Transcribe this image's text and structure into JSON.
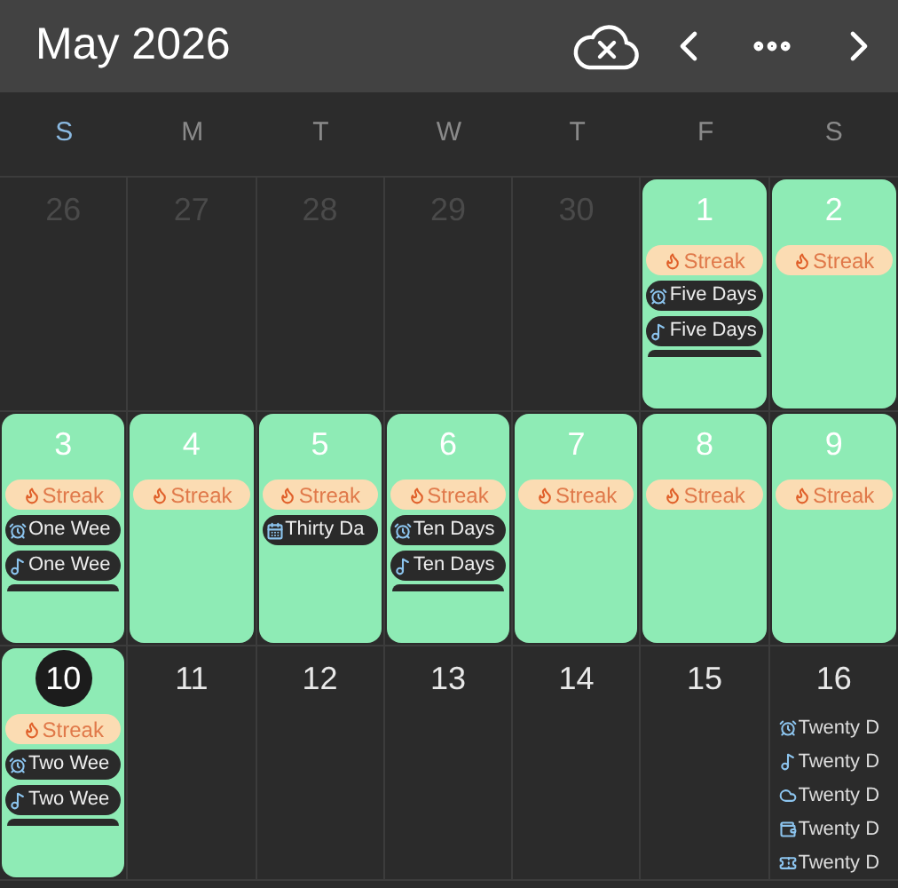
{
  "header": {
    "title": "May 2026"
  },
  "weekdays": [
    {
      "label": "S",
      "weekend": true
    },
    {
      "label": "M",
      "weekend": false
    },
    {
      "label": "T",
      "weekend": false
    },
    {
      "label": "W",
      "weekend": false
    },
    {
      "label": "T",
      "weekend": false
    },
    {
      "label": "F",
      "weekend": false
    },
    {
      "label": "S",
      "weekend": false
    }
  ],
  "weeks": [
    [
      {
        "date": "26",
        "muted": true,
        "marked": false,
        "today": false,
        "more": false
      },
      {
        "date": "27",
        "muted": true,
        "marked": false,
        "today": false,
        "more": false
      },
      {
        "date": "28",
        "muted": true,
        "marked": false,
        "today": false,
        "more": false
      },
      {
        "date": "29",
        "muted": true,
        "marked": false,
        "today": false,
        "more": false
      },
      {
        "date": "30",
        "muted": true,
        "marked": false,
        "today": false,
        "more": false
      },
      {
        "date": "1",
        "muted": false,
        "marked": true,
        "today": false,
        "events": [
          {
            "kind": "streak",
            "label": "Streak"
          },
          {
            "kind": "alarm",
            "label": "Five Days"
          },
          {
            "kind": "music",
            "label": "Five Days"
          }
        ],
        "more": true
      },
      {
        "date": "2",
        "muted": false,
        "marked": true,
        "today": false,
        "events": [
          {
            "kind": "streak",
            "label": "Streak"
          }
        ],
        "more": false
      }
    ],
    [
      {
        "date": "3",
        "muted": false,
        "marked": true,
        "today": false,
        "events": [
          {
            "kind": "streak",
            "label": "Streak"
          },
          {
            "kind": "alarm",
            "label": "One Wee"
          },
          {
            "kind": "music",
            "label": "One Wee"
          }
        ],
        "more": true
      },
      {
        "date": "4",
        "muted": false,
        "marked": true,
        "today": false,
        "events": [
          {
            "kind": "streak",
            "label": "Streak"
          }
        ],
        "more": false
      },
      {
        "date": "5",
        "muted": false,
        "marked": true,
        "today": false,
        "events": [
          {
            "kind": "streak",
            "label": "Streak"
          },
          {
            "kind": "calendar",
            "label": "Thirty Da"
          }
        ],
        "more": false
      },
      {
        "date": "6",
        "muted": false,
        "marked": true,
        "today": false,
        "events": [
          {
            "kind": "streak",
            "label": "Streak"
          },
          {
            "kind": "alarm",
            "label": "Ten Days"
          },
          {
            "kind": "music",
            "label": "Ten Days"
          }
        ],
        "more": true
      },
      {
        "date": "7",
        "muted": false,
        "marked": true,
        "today": false,
        "events": [
          {
            "kind": "streak",
            "label": "Streak"
          }
        ],
        "more": false
      },
      {
        "date": "8",
        "muted": false,
        "marked": true,
        "today": false,
        "events": [
          {
            "kind": "streak",
            "label": "Streak"
          }
        ],
        "more": false
      },
      {
        "date": "9",
        "muted": false,
        "marked": true,
        "today": false,
        "events": [
          {
            "kind": "streak",
            "label": "Streak"
          }
        ],
        "more": false
      }
    ],
    [
      {
        "date": "10",
        "muted": false,
        "marked": true,
        "today": true,
        "events": [
          {
            "kind": "streak",
            "label": "Streak"
          },
          {
            "kind": "alarm",
            "label": "Two Wee"
          },
          {
            "kind": "music",
            "label": "Two Wee"
          }
        ],
        "more": true
      },
      {
        "date": "11",
        "muted": false,
        "marked": false,
        "today": false,
        "more": false
      },
      {
        "date": "12",
        "muted": false,
        "marked": false,
        "today": false,
        "more": false
      },
      {
        "date": "13",
        "muted": false,
        "marked": false,
        "today": false,
        "more": false
      },
      {
        "date": "14",
        "muted": false,
        "marked": false,
        "today": false,
        "more": false
      },
      {
        "date": "15",
        "muted": false,
        "marked": false,
        "today": false,
        "more": false
      },
      {
        "date": "16",
        "muted": false,
        "marked": false,
        "today": false,
        "events": [
          {
            "kind": "alarm",
            "label": "Twenty D"
          },
          {
            "kind": "music",
            "label": "Twenty D"
          },
          {
            "kind": "cloud",
            "label": "Twenty D"
          },
          {
            "kind": "wallet",
            "label": "Twenty D"
          },
          {
            "kind": "ticket",
            "label": "Twenty D"
          }
        ],
        "more": false
      }
    ]
  ]
}
